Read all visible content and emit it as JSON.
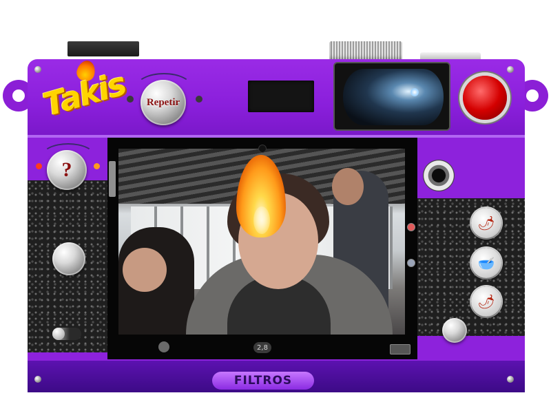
{
  "logo": {
    "text": "Takis"
  },
  "controls": {
    "repeat_label": "Repetir",
    "help_label": "?",
    "filters_label": "FILTROS"
  },
  "screen": {
    "aperture": "2,8"
  },
  "filters": [
    {
      "name": "chili-bag-filter",
      "icon": "🌶"
    },
    {
      "name": "bowl-filter",
      "icon": "🥣"
    },
    {
      "name": "pepper-filter",
      "icon": "🌶"
    }
  ],
  "colors": {
    "body": "#8d22dc",
    "accent": "#ffd400",
    "record": "#d40000"
  }
}
